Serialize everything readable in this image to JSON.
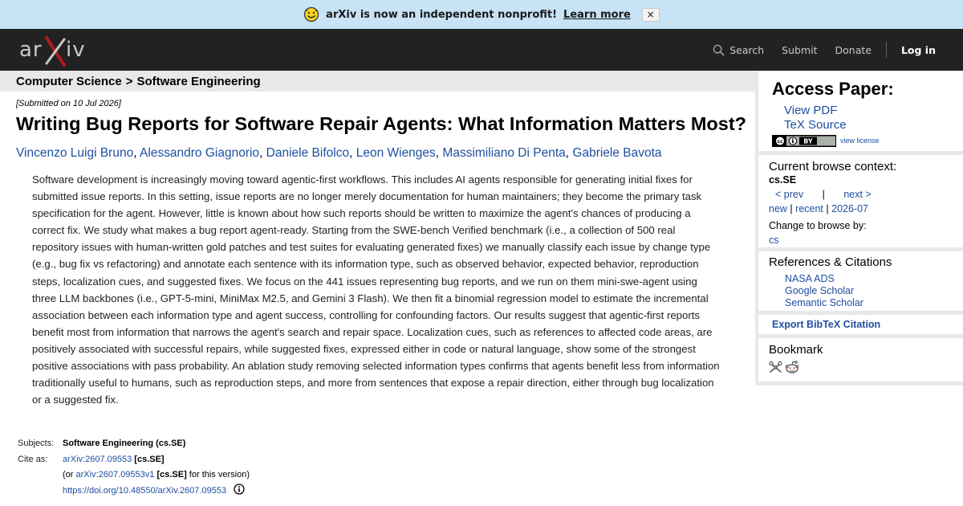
{
  "banner": {
    "message": "arXiv is now an independent nonprofit!",
    "link": "Learn more",
    "close": "×"
  },
  "header": {
    "logo_text": "arXiv",
    "nav": {
      "search": "Search",
      "submit": "Submit",
      "donate": "Donate",
      "login": "Log in"
    }
  },
  "breadcrumb": {
    "category": "Computer Science",
    "separator": ">",
    "subcategory": "Software Engineering"
  },
  "paper": {
    "dateline": "[Submitted on 10 Jul 2026]",
    "title": "Writing Bug Reports for Software Repair Agents: What Information Matters Most?",
    "authors": [
      "Vincenzo Luigi Bruno",
      "Alessandro Giagnorio",
      "Daniele Bifolco",
      "Leon Wienges",
      "Massimiliano Di Penta",
      "Gabriele Bavota"
    ],
    "abstract": "Software development is increasingly moving toward agentic-first workflows. This includes AI agents responsible for generating initial fixes for submitted issue reports. In this setting, issue reports are no longer merely documentation for human maintainers; they become the primary task specification for the agent. However, little is known about how such reports should be written to maximize the agent's chances of producing a correct fix. We study what makes a bug report agent-ready. Starting from the SWE-bench Verified benchmark (i.e., a collection of 500 real repository issues with human-written gold patches and test suites for evaluating generated fixes) we manually classify each issue by change type (e.g., bug fix vs refactoring) and annotate each sentence with its information type, such as observed behavior, expected behavior, reproduction steps, localization cues, and suggested fixes. We focus on the 441 issues representing bug reports, and we run on them mini-swe-agent using three LLM backbones (i.e., GPT-5-mini, MiniMax M2.5, and Gemini 3 Flash). We then fit a binomial regression model to estimate the incremental association between each information type and agent success, controlling for confounding factors. Our results suggest that agentic-first reports benefit most from information that narrows the agent's search and repair space. Localization cues, such as references to affected code areas, are positively associated with successful repairs, while suggested fixes, expressed either in code or natural language, show some of the strongest positive associations with pass probability. An ablation study removing selected information types confirms that agents benefit less from information traditionally useful to humans, such as reproduction steps, and more from sentences that expose a repair direction, either through bug localization or a suggested fix."
  },
  "meta": {
    "subjects_label": "Subjects:",
    "subjects_value": "Software Engineering (cs.SE)",
    "cite_label": "Cite as:",
    "cite_id": "arXiv:2607.09553",
    "cite_cat": "[cs.SE]",
    "or_open": "(or",
    "cite_version": "arXiv:2607.09553v1",
    "version_cat": "[cs.SE]",
    "version_suffix": "for this version)",
    "doi": "https://doi.org/10.48550/arXiv.2607.09553"
  },
  "sidebar": {
    "access": {
      "heading": "Access Paper:",
      "view_pdf": "View PDF",
      "tex_source": "TeX Source",
      "license_badge": "cc BY",
      "view_license": "view license"
    },
    "context": {
      "heading": "Current browse context:",
      "code": "cs.SE",
      "prev": "< prev",
      "nav_sep": "|",
      "next": "next >",
      "new": "new",
      "recent": "recent",
      "month": "2026-07",
      "pipe": "|",
      "change_label": "Change to browse by:",
      "cs": "cs"
    },
    "references": {
      "heading": "References & Citations",
      "links": [
        "NASA ADS",
        "Google Scholar",
        "Semantic Scholar"
      ]
    },
    "bibtex": "Export BibTeX Citation",
    "bookmark": {
      "heading": "Bookmark",
      "icons": [
        "bibsonomy-icon",
        "reddit-icon"
      ]
    }
  },
  "colors": {
    "banner_bg": "#c7e3f5",
    "header_bg": "#222222",
    "link": "#1f4fa0",
    "sidebar_bg": "#e8e8e8",
    "logo_x": "#b31b1b"
  }
}
